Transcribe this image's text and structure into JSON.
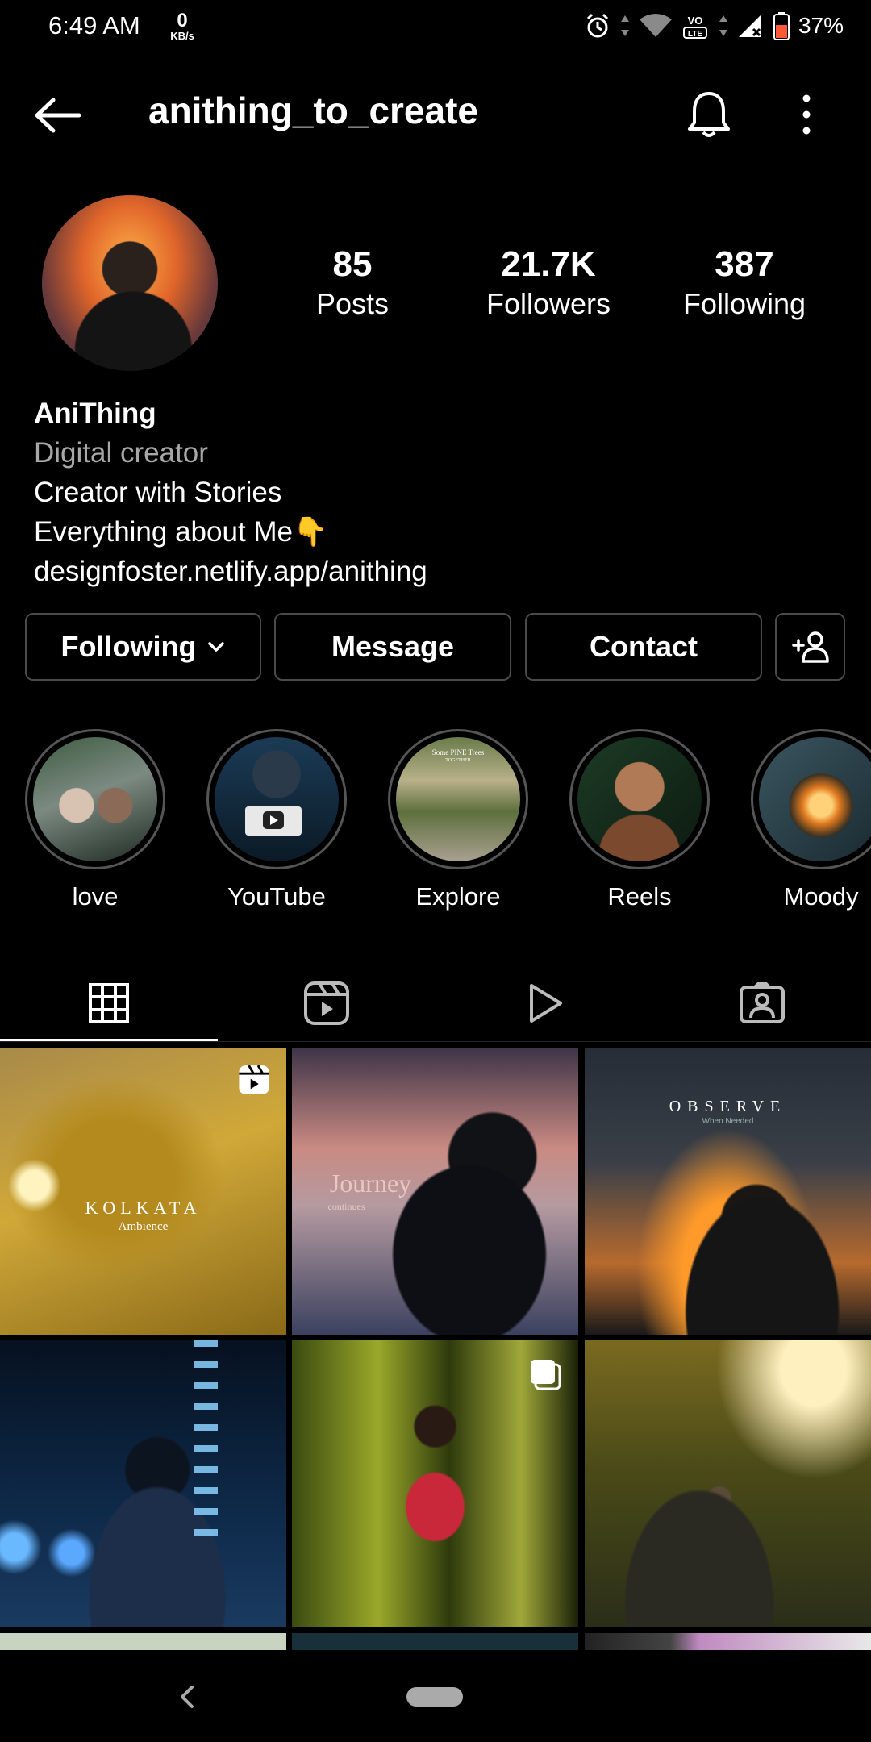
{
  "status_bar": {
    "time": "6:49 AM",
    "net_speed_value": "0",
    "net_speed_unit": "KB/s",
    "battery": "37%",
    "icons": [
      "alarm-icon",
      "wifi-icon",
      "volte-icon",
      "signal-icon",
      "battery-icon"
    ]
  },
  "header": {
    "username": "anithing_to_create",
    "icons": [
      "back-arrow-icon",
      "bell-icon",
      "more-vertical-icon"
    ]
  },
  "profile": {
    "stats": [
      {
        "value": "85",
        "label": "Posts"
      },
      {
        "value": "21.7K",
        "label": "Followers"
      },
      {
        "value": "387",
        "label": "Following"
      }
    ],
    "name": "AniThing",
    "category": "Digital creator",
    "bio_line1": "Creator with Stories",
    "bio_line2": "Everything about Me👇",
    "link": "designfoster.netlify.app/anithing"
  },
  "actions": {
    "following": "Following",
    "message": "Message",
    "contact": "Contact"
  },
  "highlights": [
    {
      "label": "love"
    },
    {
      "label": "YouTube"
    },
    {
      "label": "Explore"
    },
    {
      "label": "Reels"
    },
    {
      "label": "Moody"
    }
  ],
  "tabs": [
    "grid-icon",
    "reels-icon",
    "video-icon",
    "tagged-icon"
  ],
  "posts": [
    {
      "title": "KOLKATA",
      "subtitle": "Ambience"
    },
    {
      "title": "Journey",
      "subtitle": "continues"
    },
    {
      "title": "OBSERVE",
      "subtitle": "When Needed"
    }
  ],
  "highlight_extra_text": {
    "explore_top": "Some PINE Trees",
    "explore_sub": "TOGETHER"
  }
}
